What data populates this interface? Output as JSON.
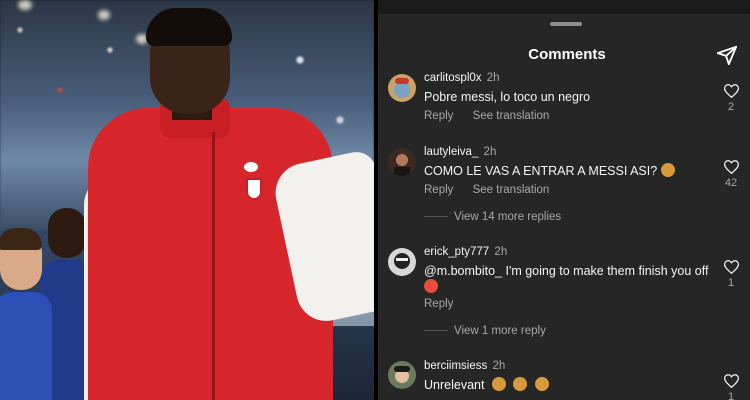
{
  "sheet": {
    "title": "Comments"
  },
  "icons": {
    "share": "paper-plane-icon",
    "like": "heart-outline-icon"
  },
  "colors": {
    "sheet_bg": "#262626",
    "text_primary": "#f5f5f5",
    "text_secondary": "#a8a8a8"
  },
  "comments": [
    {
      "username": "carlitospl0x",
      "time": "2h",
      "text": "Pobre messi, lo toco un negro",
      "reply_label": "Reply",
      "translation_label": "See translation",
      "likes": "2"
    },
    {
      "username": "lautyleiva_",
      "time": "2h",
      "text": "COMO LE VAS A ENTRAR A MESSI ASI?",
      "reply_label": "Reply",
      "translation_label": "See translation",
      "likes": "42",
      "more_replies": "View 14 more replies"
    },
    {
      "username": "erick_pty777",
      "time": "2h",
      "text": "@m.bombito_  I'm going to make them finish you off",
      "reply_label": "Reply",
      "likes": "1",
      "more_replies": "View 1 more reply"
    },
    {
      "username": "berciimsiess",
      "time": "2h",
      "text": "Unrelevant",
      "likes": "1"
    }
  ]
}
